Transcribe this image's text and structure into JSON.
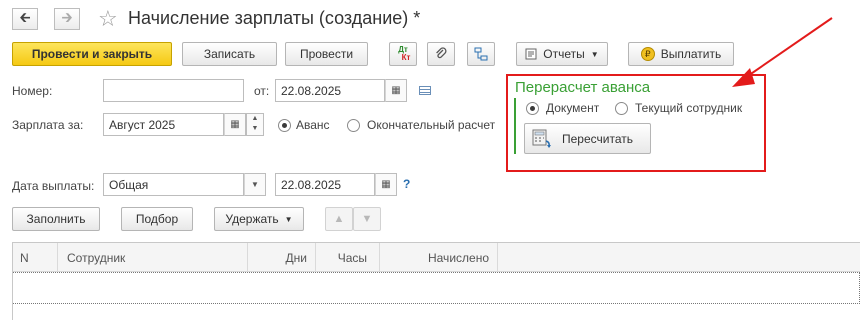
{
  "header": {
    "back_icon": "arrow-left-icon",
    "forward_icon": "arrow-right-icon",
    "favorite_icon": "star-icon",
    "title": "Начисление зарплаты (создание) *"
  },
  "toolbar": {
    "post_and_close": "Провести и закрыть",
    "save": "Записать",
    "post": "Провести",
    "dt_kt": "Дт Кт",
    "reports": "Отчеты",
    "pay": "Выплатить",
    "pay_icon_symbol": "₽"
  },
  "form": {
    "number_label": "Номер:",
    "number_value": "",
    "from_label": "от:",
    "from_value": "22.08.2025",
    "salary_for_label": "Зарплата за:",
    "salary_for_value": "Август 2025",
    "advance_label": "Аванс",
    "final_label": "Окончательный расчет",
    "payment_date_label": "Дата выплаты:",
    "payment_type_value": "Общая",
    "payment_date_value": "22.08.2025",
    "help_symbol": "?"
  },
  "recalc": {
    "title": "Перерасчет аванса",
    "document_label": "Документ",
    "current_employee_label": "Текущий сотрудник",
    "recalc_button": "Пересчитать"
  },
  "table_toolbar": {
    "fill": "Заполнить",
    "pick": "Подбор",
    "withhold": "Удержать"
  },
  "table": {
    "columns": [
      "N",
      "Сотрудник",
      "Дни",
      "Часы",
      "Начислено"
    ]
  },
  "colors": {
    "primary_button": "#f5c913",
    "group_title": "#3aa035",
    "highlight_frame": "#e31b1b"
  }
}
